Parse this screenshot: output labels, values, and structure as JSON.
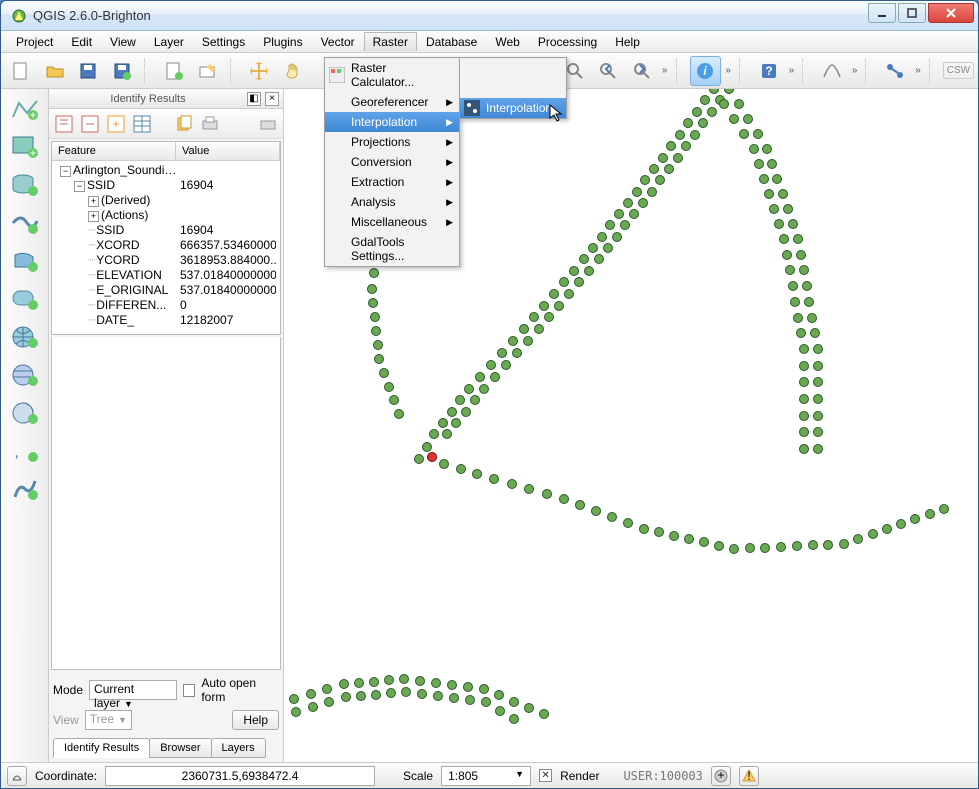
{
  "window": {
    "title": "QGIS 2.6.0-Brighton"
  },
  "menubar": {
    "items": [
      "Project",
      "Edit",
      "View",
      "Layer",
      "Settings",
      "Plugins",
      "Vector",
      "Raster",
      "Database",
      "Web",
      "Processing",
      "Help"
    ],
    "active_index": 7
  },
  "raster_menu": {
    "items": [
      {
        "label": "Raster Calculator...",
        "arrow": false,
        "icon": true
      },
      {
        "label": "Georeferencer",
        "arrow": true
      },
      {
        "label": "Interpolation",
        "arrow": true,
        "highlight": true
      },
      {
        "label": "Projections",
        "arrow": true
      },
      {
        "label": "Conversion",
        "arrow": true
      },
      {
        "label": "Extraction",
        "arrow": true
      },
      {
        "label": "Analysis",
        "arrow": true
      },
      {
        "label": "Miscellaneous",
        "arrow": true
      },
      {
        "label": "GdalTools Settings...",
        "arrow": false
      }
    ]
  },
  "submenu": {
    "items": [
      {
        "label": "Interpolation",
        "highlight": true,
        "icon": true
      }
    ]
  },
  "identify": {
    "title": "Identify Results",
    "columns": {
      "feature": "Feature",
      "value": "Value"
    },
    "root": "Arlington_Soundin...",
    "rows": [
      {
        "feat": "SSID",
        "val": "16904",
        "lvl": 2,
        "exp": "-"
      },
      {
        "feat": "(Derived)",
        "val": "",
        "lvl": 3,
        "exp": "+"
      },
      {
        "feat": "(Actions)",
        "val": "",
        "lvl": 3,
        "exp": "+"
      },
      {
        "feat": "SSID",
        "val": "16904",
        "lvl": 4
      },
      {
        "feat": "XCORD",
        "val": "666357.53460000...",
        "lvl": 4
      },
      {
        "feat": "YCORD",
        "val": "3618953.884000...",
        "lvl": 4
      },
      {
        "feat": "ELEVATION",
        "val": "537.01840000000",
        "lvl": 4
      },
      {
        "feat": "E_ORIGINAL",
        "val": "537.01840000000",
        "lvl": 4
      },
      {
        "feat": "DIFFEREN...",
        "val": "0",
        "lvl": 4
      },
      {
        "feat": "DATE_",
        "val": "12182007",
        "lvl": 4
      }
    ],
    "mode_label": "Mode",
    "mode_value": "Current layer",
    "auto_open": "Auto open form",
    "view_label": "View",
    "view_value": "Tree",
    "help": "Help",
    "tabs": [
      "Identify Results",
      "Browser",
      "Layers"
    ]
  },
  "status": {
    "coordinate_label": "Coordinate:",
    "coordinate": "2360731.5,6938472.4",
    "scale_label": "Scale",
    "scale": "1:805",
    "render": "Render",
    "user": "USER:100003"
  }
}
